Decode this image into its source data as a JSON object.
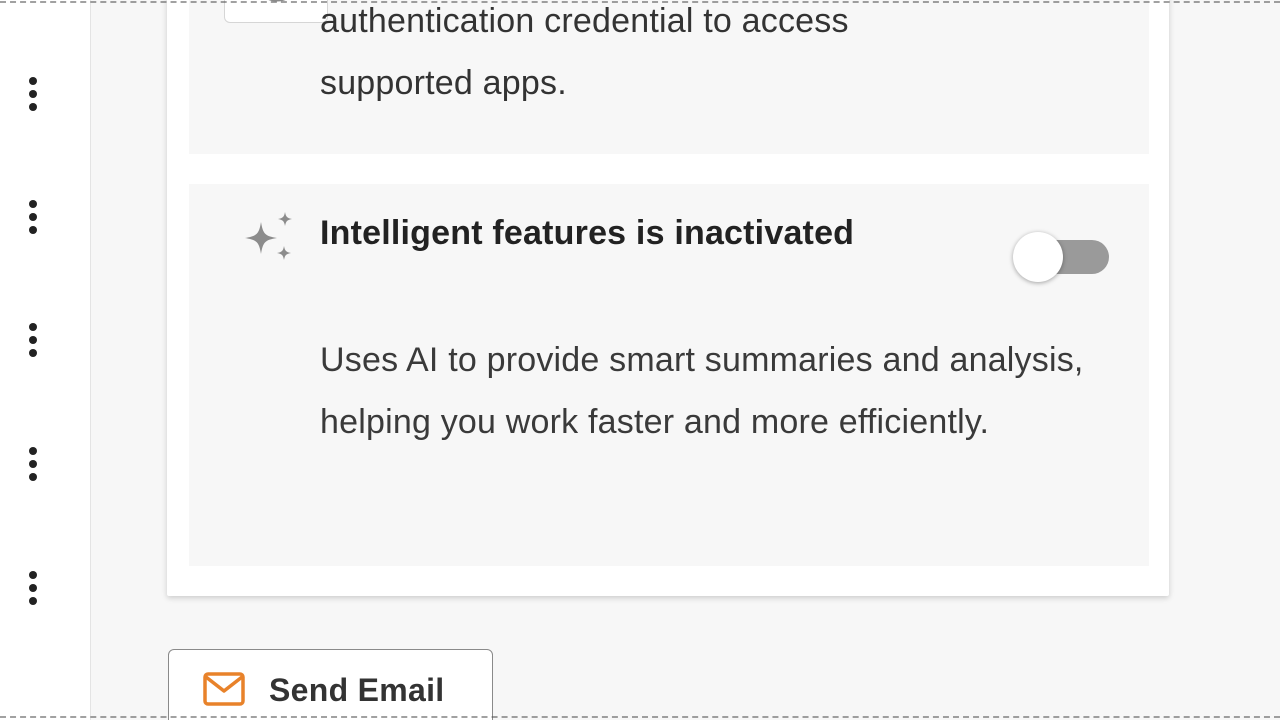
{
  "card_prev": {
    "description_line1": "authentication credential to access",
    "description_line2": "supported apps."
  },
  "intelligent_features": {
    "title": "Intelligent features is inactivated",
    "description": "Uses AI to provide smart summaries and analysis, helping you work faster and more efficiently.",
    "toggle_state": "off"
  },
  "actions": {
    "send_email_label": "Send Email"
  },
  "icons": {
    "kebab": "more-vertical-icon",
    "sparkle": "sparkle-icon",
    "mail": "mail-icon",
    "card_icon": "gear-badge-icon"
  },
  "colors": {
    "accent_mail": "#e8822a",
    "toggle_track_off": "#9a9a9a"
  }
}
